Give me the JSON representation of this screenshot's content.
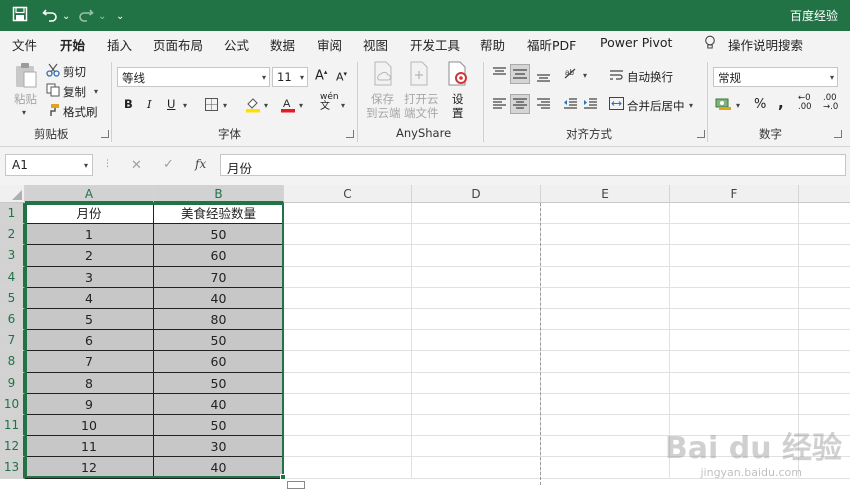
{
  "app": {
    "title": "百度经验"
  },
  "quick_access": {
    "undo_caret": "⌄",
    "customize": "⌄"
  },
  "menu": {
    "tabs": [
      {
        "label": "文件"
      },
      {
        "label": "开始"
      },
      {
        "label": "插入"
      },
      {
        "label": "页面布局"
      },
      {
        "label": "公式"
      },
      {
        "label": "数据"
      },
      {
        "label": "审阅"
      },
      {
        "label": "视图"
      },
      {
        "label": "开发工具"
      },
      {
        "label": "帮助"
      },
      {
        "label": "福昕PDF"
      },
      {
        "label": "Power Pivot"
      }
    ],
    "active_tab": "开始",
    "tell_me": "操作说明搜索"
  },
  "ribbon": {
    "clipboard": {
      "label": "剪贴板",
      "paste": "粘贴",
      "cut": "剪切",
      "copy": "复制",
      "format_painter": "格式刷"
    },
    "font": {
      "label": "字体",
      "font_name": "等线",
      "font_size": "11",
      "bold": "B",
      "italic": "I",
      "underline": "U",
      "phonetic": "wén"
    },
    "anyshare": {
      "label": "AnyShare",
      "save_cloud_1": "保存",
      "save_cloud_2": "到云端",
      "open_cloud_1": "打开云",
      "open_cloud_2": "端文件",
      "settings_1": "设",
      "settings_2": "置"
    },
    "alignment": {
      "label": "对齐方式",
      "wrap_text": "自动换行",
      "merge_center": "合并后居中"
    },
    "number": {
      "label": "数字",
      "format": "常规",
      "percent": "%",
      "comma": ","
    }
  },
  "formula_bar": {
    "name_box": "A1",
    "content": "月份",
    "fx": "fx"
  },
  "sheet": {
    "columns": [
      "A",
      "B",
      "C",
      "D",
      "E",
      "F"
    ],
    "row_numbers": [
      "1",
      "2",
      "3",
      "4",
      "5",
      "6",
      "7",
      "8",
      "9",
      "10",
      "11",
      "12",
      "13"
    ],
    "header_row": [
      "月份",
      "美食经验数量"
    ],
    "rows": [
      [
        "1",
        "50"
      ],
      [
        "2",
        "60"
      ],
      [
        "3",
        "70"
      ],
      [
        "4",
        "40"
      ],
      [
        "5",
        "80"
      ],
      [
        "6",
        "50"
      ],
      [
        "7",
        "60"
      ],
      [
        "8",
        "50"
      ],
      [
        "9",
        "40"
      ],
      [
        "10",
        "50"
      ],
      [
        "11",
        "30"
      ],
      [
        "12",
        "40"
      ]
    ]
  },
  "watermark": {
    "brand": "Bai du 经验",
    "url": "jingyan.baidu.com"
  },
  "colors": {
    "accent": "#217346",
    "selection_fill": "#c7c7c7"
  }
}
